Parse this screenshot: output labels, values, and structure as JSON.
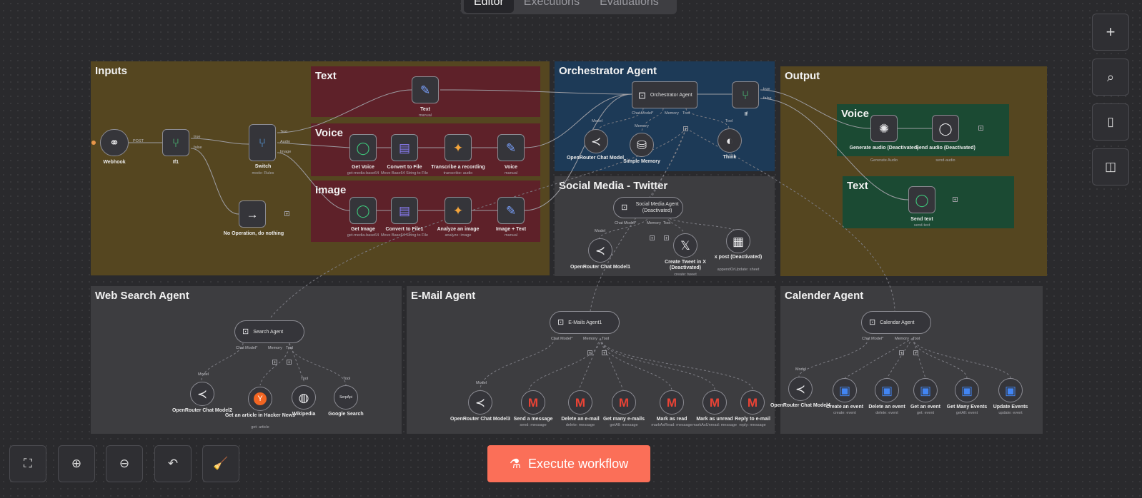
{
  "tabs": {
    "editor": "Editor",
    "executions": "Executions",
    "evaluations": "Evaluations"
  },
  "stickies": {
    "inputs": "Inputs",
    "text": "Text",
    "voice": "Voice",
    "image": "Image",
    "orchestrator": "Orchestrator Agent",
    "output": "Output",
    "output_voice": "Voice",
    "output_text": "Text",
    "social": "Social Media - Twitter",
    "websearch": "Web Search Agent",
    "email": "E-Mail Agent",
    "calendar": "Calender Agent"
  },
  "nodes": {
    "webhook": {
      "label": "Webhook",
      "port": "POST"
    },
    "if1": {
      "label": "If1",
      "true": "true",
      "false": "false"
    },
    "switch": {
      "label": "Switch",
      "sub": "mode: Rules",
      "out_text": "Text",
      "out_audio": "Audio",
      "out_image": "Image"
    },
    "noop": {
      "label": "No Operation, do nothing"
    },
    "text": {
      "label": "Text",
      "sub": "manual"
    },
    "get_voice": {
      "label": "Get Voice",
      "sub": "get-media-base64"
    },
    "convert_file": {
      "label": "Convert to File",
      "sub": "Move Base64 String to File"
    },
    "transcribe": {
      "label": "Transcribe a recording",
      "sub": "transcribe: audio"
    },
    "voice": {
      "label": "Voice",
      "sub": "manual"
    },
    "get_image": {
      "label": "Get Image",
      "sub": "get-media-base64"
    },
    "convert_file1": {
      "label": "Convert to File1",
      "sub": "Move Base64 String to File"
    },
    "analyze_image": {
      "label": "Analyze an image",
      "sub": "analyze: image"
    },
    "image_text": {
      "label": "Image + Text",
      "sub": "manual"
    },
    "orchestrator": {
      "label": "Orchestrator Agent",
      "chat": "Chat Model*",
      "memory": "Memory",
      "tool": "Tool"
    },
    "or_chat": {
      "label": "OpenRouter Chat Model",
      "port": "Model"
    },
    "simple_memory": {
      "label": "Simple Memory",
      "port": "Memory"
    },
    "think": {
      "label": "Think",
      "port": "Tool"
    },
    "if_out": {
      "label": "If",
      "true": "true",
      "false": "false"
    },
    "gen_audio": {
      "label": "Generate audio (Deactivated)",
      "sub": "Generate Audio"
    },
    "send_audio": {
      "label": "Send audio (Deactivated)",
      "sub": "send-audio"
    },
    "send_text": {
      "label": "Send text",
      "sub": "send-text"
    },
    "social_agent": {
      "label": "Social Media Agent (Deactivated)",
      "chat": "Chat Model*",
      "memory": "Memory",
      "tool": "Tool"
    },
    "or_chat1": {
      "label": "OpenRouter Chat Model1",
      "port": "Model"
    },
    "create_tweet": {
      "label": "Create Tweet in X (Deactivated)",
      "sub": "create: tweet"
    },
    "x_post": {
      "label": "x post (Deactivated)",
      "sub": "appendOrUpdate: sheet"
    },
    "search_agent": {
      "label": "Search Agent",
      "chat": "Chat Model*",
      "memory": "Memory",
      "tool": "Tool"
    },
    "or_chat2": {
      "label": "OpenRouter Chat Model2",
      "port": "Model"
    },
    "hacker_news": {
      "label": "Get an article in Hacker News",
      "sub": "get: article"
    },
    "wikipedia": {
      "label": "Wikipedia",
      "port": "Tool"
    },
    "google_search": {
      "label": "Google Search",
      "port": "Tool",
      "badge": "SerpApi"
    },
    "emails_agent": {
      "label": "E-Mails Agent1",
      "chat": "Chat Model*",
      "memory": "Memory",
      "tool": "Tool"
    },
    "or_chat3": {
      "label": "OpenRouter Chat Model3",
      "port": "Model"
    },
    "send_message": {
      "label": "Send a message",
      "sub": "send: message"
    },
    "delete_email": {
      "label": "Delete an e-mail",
      "sub": "delete: message"
    },
    "get_many_emails": {
      "label": "Get many e-mails",
      "sub": "getAll: message"
    },
    "mark_read": {
      "label": "Mark as read",
      "sub": "markAsRead: message"
    },
    "mark_unread": {
      "label": "Mark as unread",
      "sub": "markAsUnread: message"
    },
    "reply_email": {
      "label": "Reply to e-mail",
      "sub": "reply: message"
    },
    "calendar_agent": {
      "label": "Calendar Agent",
      "chat": "Chat Model*",
      "memory": "Memory",
      "tool": "Tool"
    },
    "or_chat4": {
      "label": "OpenRouter Chat Model4",
      "port": "Model"
    },
    "create_event": {
      "label": "Create an event",
      "sub": "create: event"
    },
    "delete_event": {
      "label": "Delete an event",
      "sub": "delete: event"
    },
    "get_event": {
      "label": "Get an event",
      "sub": "get: event"
    },
    "get_many_events": {
      "label": "Get Many Events",
      "sub": "getAll: event"
    },
    "update_events": {
      "label": "Update Events",
      "sub": "update: event"
    }
  },
  "controls": {
    "execute": "Execute workflow"
  },
  "colors": {
    "inputs": "#554620",
    "red": "#5e2129",
    "blue": "#1d3a57",
    "green": "#1b4a33",
    "gray": "#3d3d40",
    "accent": "#fb6f58"
  }
}
